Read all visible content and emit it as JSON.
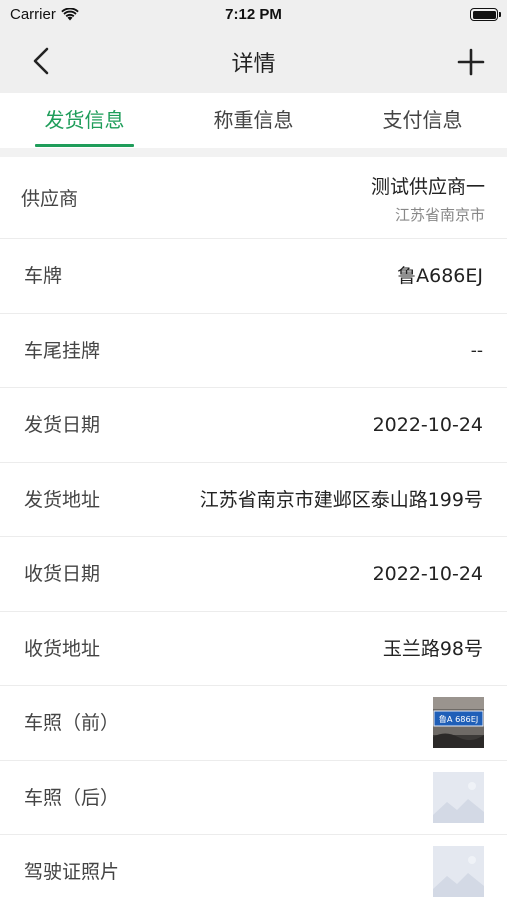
{
  "status_bar": {
    "carrier": "Carrier",
    "time": "7:12 PM"
  },
  "nav": {
    "title": "详情",
    "back_icon": "chevron-left-icon",
    "add_icon": "plus-icon"
  },
  "tabs": [
    {
      "label": "发货信息",
      "active": true
    },
    {
      "label": "称重信息",
      "active": false
    },
    {
      "label": "支付信息",
      "active": false
    }
  ],
  "supplier": {
    "label": "供应商",
    "name": "测试供应商一",
    "location": "江苏省南京市"
  },
  "rows": {
    "plate": {
      "label": "车牌",
      "value": "鲁A686EJ"
    },
    "trailer_plate": {
      "label": "车尾挂牌",
      "value": "--"
    },
    "ship_date": {
      "label": "发货日期",
      "value": "2022-10-24"
    },
    "ship_address": {
      "label": "发货地址",
      "value": "江苏省南京市建邺区泰山路199号"
    },
    "receive_date": {
      "label": "收货日期",
      "value": "2022-10-24"
    },
    "receive_address": {
      "label": "收货地址",
      "value": "玉兰路98号"
    },
    "car_photo_front": {
      "label": "车照（前）",
      "plate_text": "鲁A 686EJ"
    },
    "car_photo_back": {
      "label": "车照（后）"
    },
    "license_photo": {
      "label": "驾驶证照片"
    }
  },
  "colors": {
    "accent": "#1f9d5a",
    "nav_bg": "#efefef",
    "placeholder": "#dfe4ee"
  }
}
